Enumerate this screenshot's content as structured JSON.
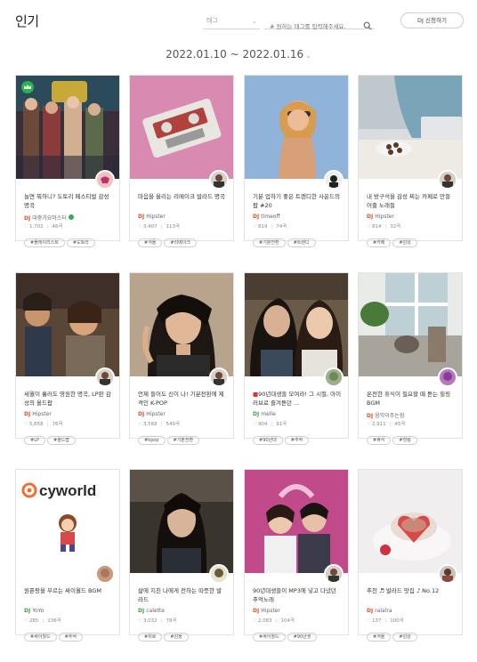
{
  "header": {
    "title": "인기",
    "tag_select": {
      "label": "태그",
      "icon": "chevron-down-icon"
    },
    "search": {
      "placeholder": "# 원하는 태그를 입력해주세요.",
      "icon": "search-icon"
    },
    "apply_button": "DJ 신청하기"
  },
  "date_range": {
    "label": "2022.01.10 ~ 2022.01.16",
    "icon": "chevron-down-icon"
  },
  "cards": [
    {
      "title": "놀면 뭐하니? 도토리 페스티벌 감성 명곡",
      "dj": "대중가요마스터",
      "dj_color": "red",
      "verified": true,
      "crown": true,
      "likes": "1,702",
      "tracks": "46곡",
      "tags": [
        "#플레이리스트",
        "#도토리"
      ],
      "title_dot": false
    },
    {
      "title": "마음을 울리는 리메이크 발라드 명곡",
      "dj": "Hipster",
      "dj_color": "red",
      "verified": false,
      "crown": false,
      "likes": "3,407",
      "tracks": "113곡",
      "tags": [
        "#겨울",
        "#리메이크"
      ],
      "title_dot": false
    },
    {
      "title": "기분 업하기 좋은 트렌디한 사운드의 팝 #20",
      "dj": "timeoff",
      "dj_color": "red",
      "verified": false,
      "crown": false,
      "likes": "819",
      "tracks": "74곡",
      "tags": [
        "#기분전환",
        "#트렌디"
      ],
      "title_dot": false
    },
    {
      "title": "내 방구석을 감성 찌는 카페로 만들어줄 노래들",
      "dj": "Hipster",
      "dj_color": "red",
      "verified": false,
      "crown": false,
      "likes": "814",
      "tracks": "32곡",
      "tags": [
        "#카페",
        "#감성"
      ],
      "title_dot": false
    },
    {
      "title": "세월이 흘러도 영원한 명곡, LP판 감성의 올드팝",
      "dj": "Hipster",
      "dj_color": "red",
      "verified": false,
      "crown": false,
      "likes": "5,658",
      "tracks": "76곡",
      "tags": [
        "#LP",
        "#올드팝"
      ],
      "title_dot": false
    },
    {
      "title": "언제 들어도 신이 나! 기분전환에 제격인 K-POP",
      "dj": "Hipster",
      "dj_color": "red",
      "verified": false,
      "crown": false,
      "likes": "3,568",
      "tracks": "549곡",
      "tags": [
        "#kpop",
        "#기분전환"
      ],
      "title_dot": false
    },
    {
      "title": "90년대생들 모여라! 그 시절, 아이러브로 즐겨듣던 ...",
      "dj": "melle",
      "dj_color": "green",
      "verified": false,
      "crown": false,
      "likes": "904",
      "tracks": "91곡",
      "tags": [
        "#90년대",
        "#추억"
      ],
      "title_dot": true
    },
    {
      "title": "온전한 휴식이 필요할 때 듣는 힐링 BGM",
      "dj": "음악이주는힘",
      "dj_color": "red",
      "verified": false,
      "crown": false,
      "likes": "2,911",
      "tracks": "45곡",
      "tags": [
        "#휴식",
        "#힐링"
      ],
      "title_dot": false
    },
    {
      "title": "원픈팡을 부르는 싸이월드 BGM",
      "dj": "YoYo",
      "dj_color": "green",
      "verified": false,
      "crown": false,
      "likes": "285",
      "tracks": "136곡",
      "tags": [
        "#싸이월드",
        "#추억"
      ],
      "title_dot": false
    },
    {
      "title": "삶에 지친 나에게 전하는 따뜻한 발라드",
      "dj": "calette",
      "dj_color": "green",
      "verified": false,
      "crown": false,
      "likes": "3,032",
      "tracks": "78곡",
      "tags": [
        "#위로",
        "#감정"
      ],
      "title_dot": false
    },
    {
      "title": "90년대생들이 MP3에 넣고 다녔던 추억노래",
      "dj": "Hipster",
      "dj_color": "red",
      "verified": false,
      "crown": false,
      "likes": "2,083",
      "tracks": "104곡",
      "tags": [
        "#싸이월드",
        "#90년생"
      ],
      "title_dot": false
    },
    {
      "title": "추천 ♬ 발라드 맛집 ♪ No.12",
      "dj": "ralalra",
      "dj_color": "red",
      "verified": false,
      "crown": false,
      "likes": "137",
      "tracks": "100곡",
      "tags": [
        "#겨울",
        "#감성"
      ],
      "title_dot": false
    }
  ],
  "thumb_text": {
    "cyworld": "cyworld"
  },
  "colors": {
    "accent_red": "#e0532a",
    "accent_green": "#3ba746",
    "verified": "#2bb24c"
  }
}
